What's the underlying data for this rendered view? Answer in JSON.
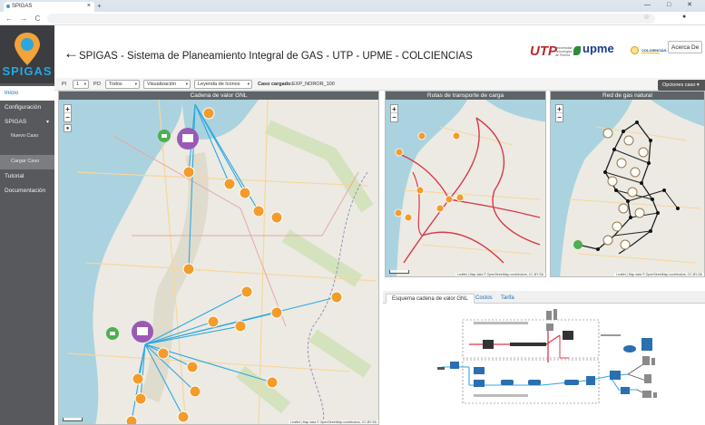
{
  "browser": {
    "tab_title": "SPIGAS",
    "tab_close": "×",
    "new_tab": "+",
    "nav_buttons": "← → C ⓘ",
    "window_controls": "— □ ✕"
  },
  "sidebar": {
    "logo_text": "SPIGAS",
    "items": [
      {
        "label": "Inicio"
      },
      {
        "label": "Configuración"
      },
      {
        "label": "SPIGAS"
      },
      {
        "label": "Nuevo Caso"
      },
      {
        "label": "Cargar Caso"
      },
      {
        "label": "Tutorial"
      },
      {
        "label": "Documentación"
      }
    ]
  },
  "header": {
    "back_arrow": "←",
    "title": "SPIGAS - Sistema de Planeamiento Integral de GAS - UTP - UPME - COLCIENCIAS",
    "logos": {
      "utp": "UTP",
      "upme": "upme",
      "colciencias": "COLCIENCIAS"
    },
    "about_button": "Acerca De"
  },
  "toolbar": {
    "pi_label": "PI",
    "pi_value": "1",
    "po_label": "PO",
    "po_value": "Todos",
    "visualizacion": "Visualización",
    "leyenda": "Leyenda de íconos",
    "case_label": "Caso cargado:",
    "case_value": "EXP_NOROR_100",
    "opciones": "Opciones caso"
  },
  "panels": {
    "gnl": {
      "title": "Cadena de valor GNL"
    },
    "rutas": {
      "title": "Rutas de transporte de carga"
    },
    "red": {
      "title": "Red de gas natural"
    },
    "attribution": "Leaflet | Map data © OpenStreetMap contributors, CC-BY-SA"
  },
  "bottom_tabs": [
    {
      "label": "Esquema cadena de valor GNL"
    },
    {
      "label": "Costos"
    },
    {
      "label": "Tarifa"
    }
  ],
  "colors": {
    "sidebar": "#57595c",
    "accent": "#29a7e1",
    "route_line": "#2fa8e0",
    "terminal": "#9b59b6",
    "node": "#f39c2b",
    "plant": "#4caf50"
  }
}
